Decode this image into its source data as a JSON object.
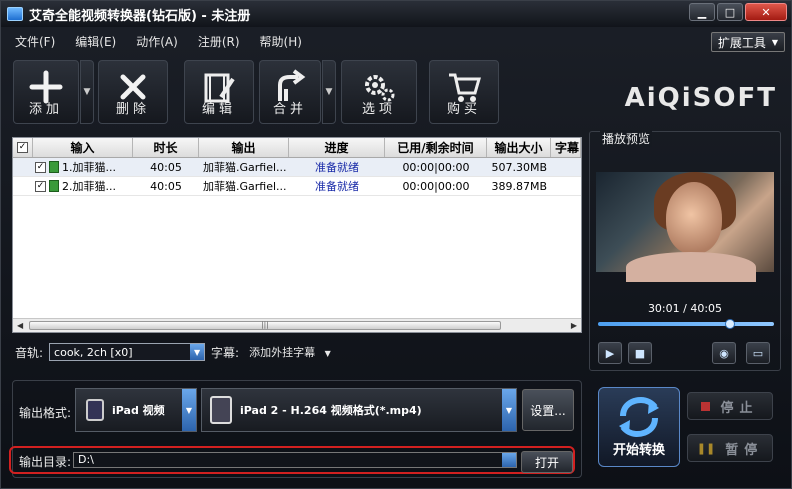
{
  "window": {
    "title": "艾奇全能视频转换器(钻石版) - 未注册",
    "min": "▁",
    "max": "□",
    "close": "✕"
  },
  "menu": [
    "文件(F)",
    "编辑(E)",
    "动作(A)",
    "注册(R)",
    "帮助(H)"
  ],
  "extend_button": "扩展工具",
  "toolbar": {
    "add": "添加",
    "delete": "删除",
    "edit": "编辑",
    "merge": "合并",
    "options": "选项",
    "buy": "购买"
  },
  "logo": "AiQiSOFT",
  "table": {
    "headers": [
      "输入",
      "时长",
      "输出",
      "进度",
      "已用/剩余时间",
      "输出大小",
      "字幕"
    ],
    "rows": [
      {
        "input": "1.加菲猫...",
        "duration": "40:05",
        "output": "加菲猫.Garfiel...",
        "progress": "准备就绪",
        "time": "00:00|00:00",
        "size": "507.30MB"
      },
      {
        "input": "2.加菲猫...",
        "duration": "40:05",
        "output": "加菲猫.Garfiel...",
        "progress": "准备就绪",
        "time": "00:00|00:00",
        "size": "389.87MB"
      }
    ]
  },
  "audio": {
    "label": "音轨:",
    "value": "cook, 2ch [x0]",
    "subtitle_label": "字幕:",
    "subtitle_value": "添加外挂字幕"
  },
  "preview": {
    "title": "播放预览",
    "time": "30:01 / 40:05",
    "progress": 0.749
  },
  "output": {
    "format_label": "输出格式:",
    "category": "iPad 视频",
    "format": "iPad 2 - H.264 视频格式(*.mp4)",
    "settings": "设置...",
    "dir_label": "输出目录:",
    "dir_value": "D:\\",
    "open": "打开"
  },
  "actions": {
    "start": "开始转换",
    "stop": "停止",
    "pause": "暂停"
  }
}
